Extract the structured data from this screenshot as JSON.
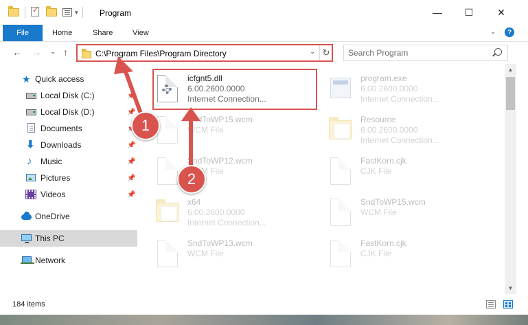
{
  "window": {
    "title": "Program",
    "minimize_glyph": "—",
    "maximize_glyph": "☐",
    "close_glyph": "✕"
  },
  "ribbon": {
    "tabs": [
      "File",
      "Home",
      "Share",
      "View"
    ],
    "expand_glyph": "⌄",
    "help_glyph": "?"
  },
  "nav": {
    "back_glyph": "←",
    "forward_glyph": "→",
    "recent_glyph": "⌄",
    "up_glyph": "↑",
    "address": "C:\\Program Files\\Program Directory",
    "address_dropdown_glyph": "⌄",
    "refresh_glyph": "↻",
    "search_placeholder": "Search Program"
  },
  "sidebar": {
    "items": [
      {
        "label": "Quick access",
        "icon": "star-icon"
      },
      {
        "label": "Local Disk (C:)",
        "icon": "drive-icon",
        "pinned": true
      },
      {
        "label": "Local Disk (D:)",
        "icon": "drive-icon",
        "pinned": true
      },
      {
        "label": "Documents",
        "icon": "documents-icon",
        "pinned": true
      },
      {
        "label": "Downloads",
        "icon": "download-icon",
        "pinned": true
      },
      {
        "label": "Music",
        "icon": "music-icon",
        "pinned": true
      },
      {
        "label": "Pictures",
        "icon": "pictures-icon",
        "pinned": true
      },
      {
        "label": "Videos",
        "icon": "videos-icon",
        "pinned": true
      },
      {
        "label": "OneDrive",
        "icon": "cloud-icon"
      },
      {
        "label": "This PC",
        "icon": "computer-icon",
        "selected": true
      },
      {
        "label": "Network",
        "icon": "network-icon"
      }
    ],
    "pin_glyph": "📌"
  },
  "files": [
    {
      "name": "icfgnt5.dll",
      "line2": "6.00.2600.0000",
      "line3": "Internet Connection...",
      "icon": "dll-gear-icon",
      "highlighted": true
    },
    {
      "name": "program.exe",
      "line2": "6.00.2600.0000",
      "line3": "Internet Connection...",
      "icon": "exe-icon"
    },
    {
      "name": "SndToWP15.wcm",
      "line2": "WCM File",
      "line3": "",
      "icon": "file-icon"
    },
    {
      "name": "Resource",
      "line2": "6.00.2600.0000",
      "line3": "Internet Connection...",
      "icon": "folder-icon"
    },
    {
      "name": "SndToWP12.wcm",
      "line2": "WCM File",
      "line3": "",
      "icon": "file-icon"
    },
    {
      "name": "FastKorn.cjk",
      "line2": "CJK File",
      "line3": "",
      "icon": "file-icon"
    },
    {
      "name": "x64",
      "line2": "6.00.2600.0000",
      "line3": "Internet Connection...",
      "icon": "folder-icon"
    },
    {
      "name": "SndToWP15.wcm",
      "line2": "WCM File",
      "line3": "",
      "icon": "file-icon"
    },
    {
      "name": "SndToWP13.wcm",
      "line2": "WCM File",
      "line3": "",
      "icon": "file-icon"
    },
    {
      "name": "FastKorn.cjk",
      "line2": "CJK File",
      "line3": "",
      "icon": "file-icon"
    }
  ],
  "status": {
    "item_count": "184 items"
  },
  "annotations": {
    "marker_1": "1",
    "marker_2": "2",
    "color": "#d9534f"
  },
  "colors": {
    "accent": "#1979ca",
    "highlight": "#d9534f"
  }
}
